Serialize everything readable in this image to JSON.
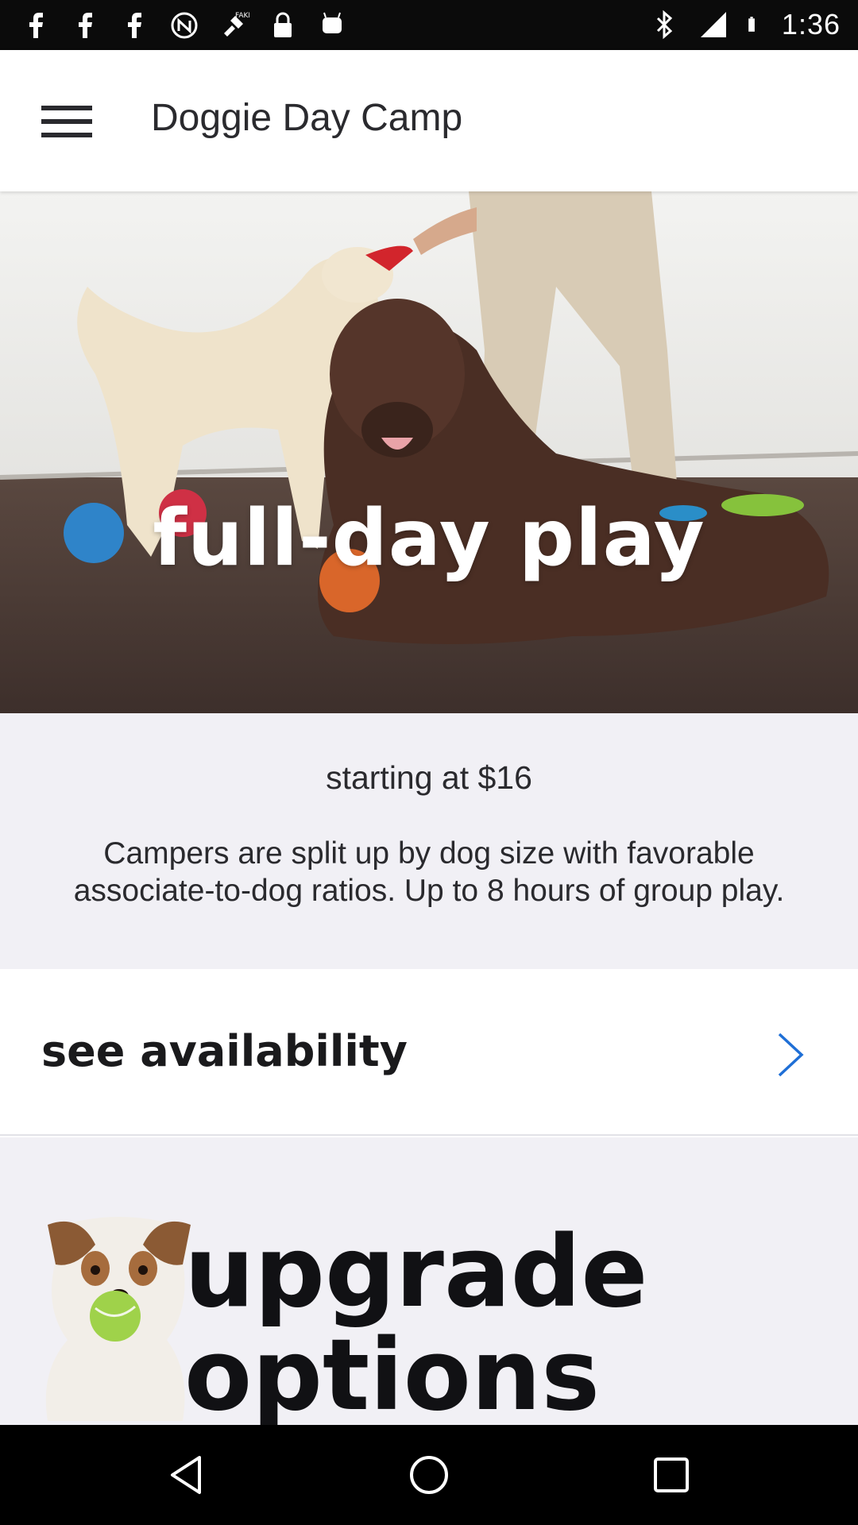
{
  "status_bar": {
    "time": "1:36",
    "icons": [
      "facebook-icon",
      "facebook-icon",
      "facebook-icon",
      "nfc-icon",
      "fake-gps-icon",
      "lock-icon",
      "android-debug-icon",
      "bluetooth-icon",
      "signal-icon",
      "battery-icon"
    ]
  },
  "app_bar": {
    "title": "Doggie Day Camp",
    "menu_icon": "hamburger-menu-icon"
  },
  "hero": {
    "title": "full-day play"
  },
  "info": {
    "price": "starting at $16",
    "description": "Campers are split up by dog size with favorable associate-to-dog ratios. Up to 8 hours of group play."
  },
  "availability": {
    "label": "see availability",
    "icon": "chevron-right-icon",
    "accent": "#1f6fd6"
  },
  "upgrade": {
    "title_line1": "upgrade",
    "title_line2": "options"
  },
  "nav_bar": {
    "back": "back-icon",
    "home": "home-icon",
    "recents": "recents-icon"
  }
}
